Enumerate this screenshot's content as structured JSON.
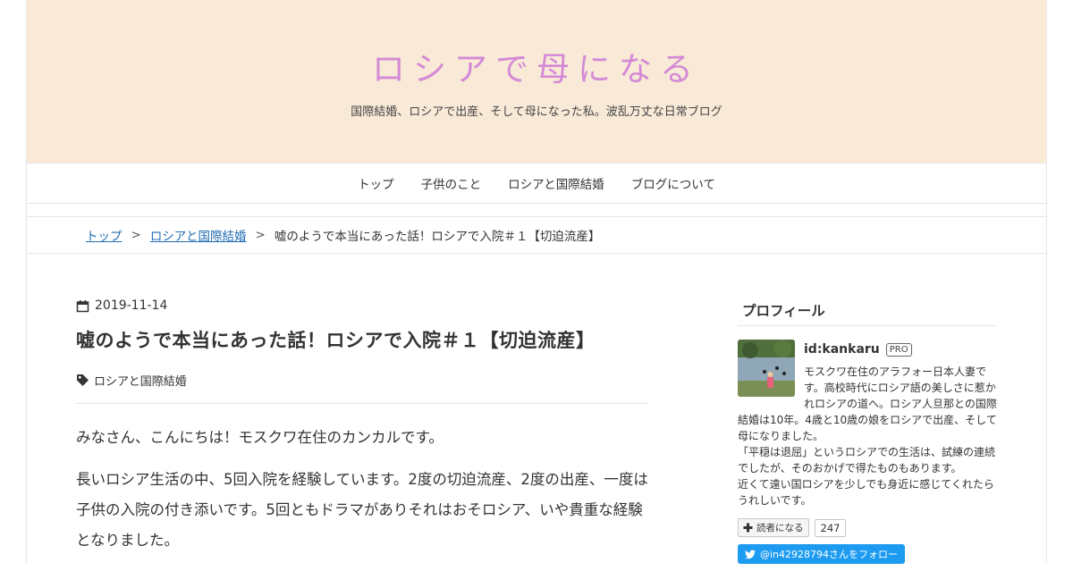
{
  "header": {
    "site_title": "ロシアで母になる",
    "site_description": "国際結婚、ロシアで出産、そして母になった私。波乱万丈な日常ブログ"
  },
  "global_nav": {
    "items": [
      {
        "label": "トップ"
      },
      {
        "label": "子供のこと"
      },
      {
        "label": "ロシアと国際結婚"
      },
      {
        "label": "ブログについて"
      }
    ]
  },
  "breadcrumb": {
    "home": "トップ",
    "category": "ロシアと国際結婚",
    "current": "嘘のようで本当にあった話！ロシアで入院＃１【切迫流産】",
    "separator": ">"
  },
  "article": {
    "date": "2019-11-14",
    "title": "嘘のようで本当にあった話！ロシアで入院＃１【切迫流産】",
    "category": "ロシアと国際結婚",
    "paragraphs": [
      "みなさん、こんにちは！モスクワ在住のカンカルです。",
      "長いロシア生活の中、5回入院を経験しています。2度の切迫流産、2度の出産、一度は子供の入院の付き添いです。5回ともドラマがありそれはおそロシア、いや貴重な経験となりました。"
    ]
  },
  "sidebar": {
    "profile_heading": "プロフィール",
    "user_id": "id:kankaru",
    "pro_badge": "PRO",
    "bio_lines": [
      "モスクワ在住のアラフォー日本人妻で",
      "す。高校時代にロシア語の美しさに惹か",
      "れロシアの道へ。ロシア人旦那との国際",
      "結婚は10年。4歳と10歳の娘をロシアで出産、そして",
      "母になりました。",
      "「平穏は退屈」というロシアでの生活は、試練の連続",
      "でしたが、そのおかげで得たものもあります。",
      "近くて遠い国ロシアを少しでも身近に感じてくれたら",
      "うれしいです。"
    ],
    "reader_button": "読者になる",
    "reader_count": "247",
    "twitter_follow": "@in42928794さんをフォロー"
  },
  "colors": {
    "header_bg": "#f9e9d7",
    "title_color": "#d48ad6",
    "link": "#1f6bb3",
    "twitter": "#1d9bf0"
  }
}
